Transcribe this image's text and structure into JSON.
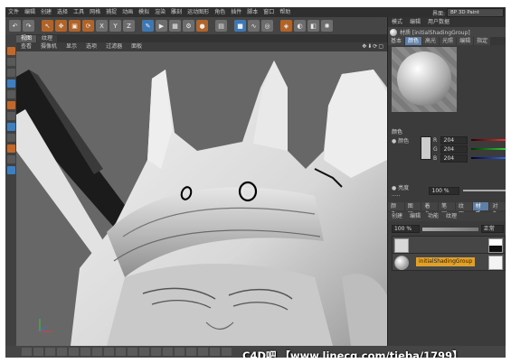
{
  "menubar": {
    "items": [
      "文件",
      "编辑",
      "创建",
      "选择",
      "工具",
      "网格",
      "捕捉",
      "动画",
      "模拟",
      "渲染",
      "雕刻",
      "运动图形",
      "角色",
      "插件",
      "脚本",
      "窗口",
      "帮助"
    ],
    "layout_label": "界面:",
    "layout_value": "BP 3D Paint"
  },
  "viewport": {
    "tabs": [
      {
        "label": "视图"
      },
      {
        "label": "纹理"
      }
    ],
    "menu": [
      "查看",
      "摄像机",
      "显示",
      "选项",
      "过滤器",
      "面板"
    ],
    "nav_icons": "✥⬇⟳▢"
  },
  "right_panel": {
    "menu": [
      "模式",
      "编辑",
      "用户数据"
    ],
    "title": "材质 [initialShadingGroup]",
    "tabs": [
      "基本",
      "颜色",
      "高光",
      "光照",
      "编辑",
      "指定"
    ],
    "active_tab": "颜色",
    "section": "颜色",
    "color_label": "● 颜色",
    "swatch_color": "#cccccc",
    "r": "204",
    "g": "204",
    "b": "204",
    "brightness_label": "● 亮度 .....",
    "brightness": "100 %",
    "lower_tabs": [
      "颜色",
      "图层",
      "着色",
      "笔刷",
      "纹理",
      "材质",
      "对象"
    ],
    "active_lower_tab": "材质",
    "sub_menu": [
      "创建",
      "编辑",
      "功能",
      "纹理"
    ],
    "layer_opacity": "100 %",
    "blend_mode": "正常",
    "material_name": "initialShadingGroup"
  },
  "watermark": "C4D吧 【www.linecg.com/tieba/1799】"
}
